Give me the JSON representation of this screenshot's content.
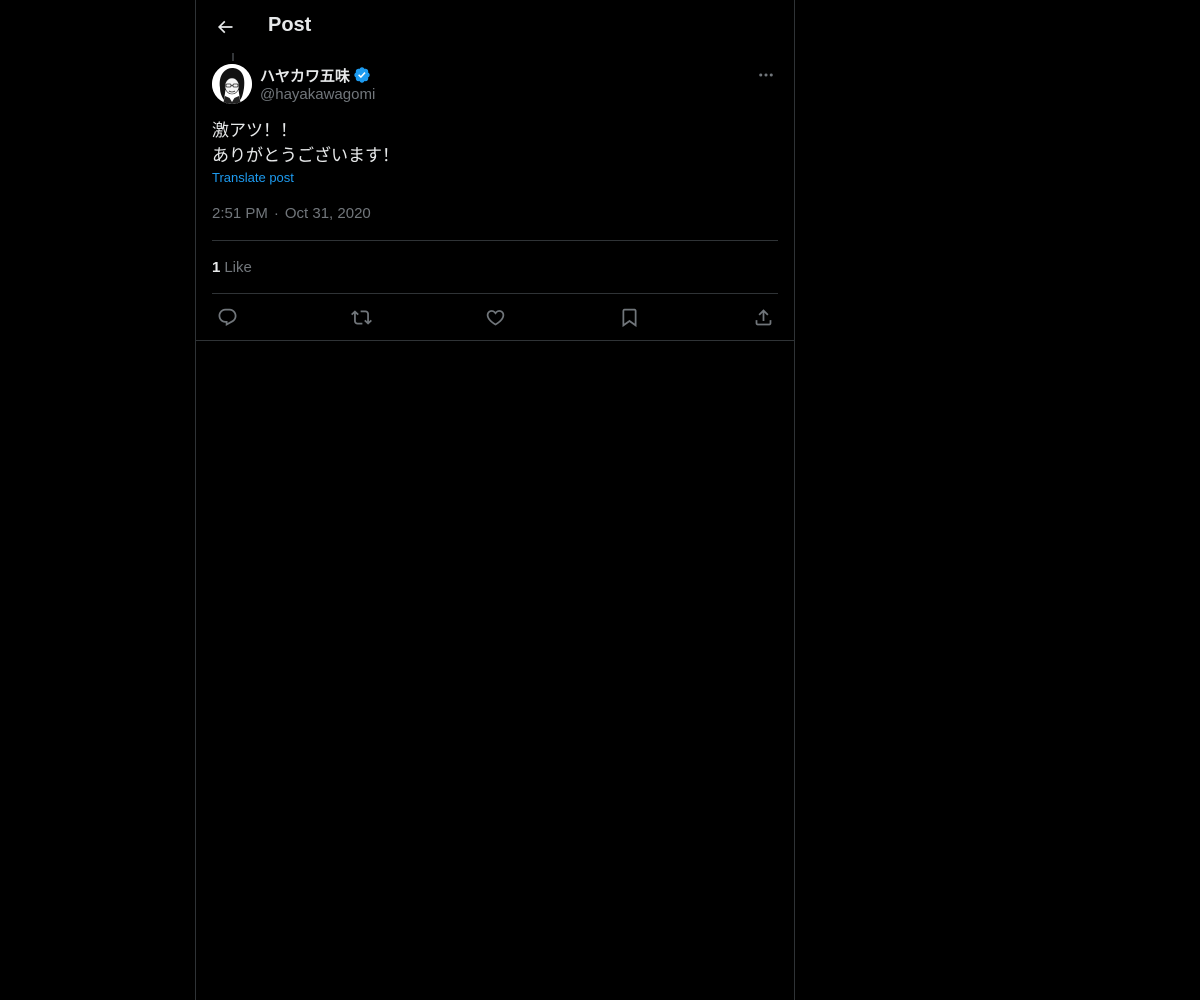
{
  "header": {
    "title": "Post",
    "back_icon": "arrow-left-icon"
  },
  "post": {
    "author": {
      "display_name": "ハヤカワ五味",
      "handle": "@hayakawagomi",
      "verified": true,
      "verified_color": "#1d9bf0"
    },
    "text": "激アツ！！\nありがとうございます！",
    "translate_label": "Translate post",
    "time": "2:51 PM",
    "separator": "·",
    "date": "Oct 31, 2020",
    "stats": {
      "likes_count": "1",
      "likes_label": "Like"
    },
    "actions": [
      {
        "icon": "reply-icon"
      },
      {
        "icon": "repost-icon"
      },
      {
        "icon": "like-icon"
      },
      {
        "icon": "bookmark-icon"
      },
      {
        "icon": "share-icon"
      }
    ]
  },
  "colors": {
    "background": "#000000",
    "border": "#2f3336",
    "text_primary": "#e7e9ea",
    "text_secondary": "#71767b",
    "accent": "#1d9bf0"
  }
}
